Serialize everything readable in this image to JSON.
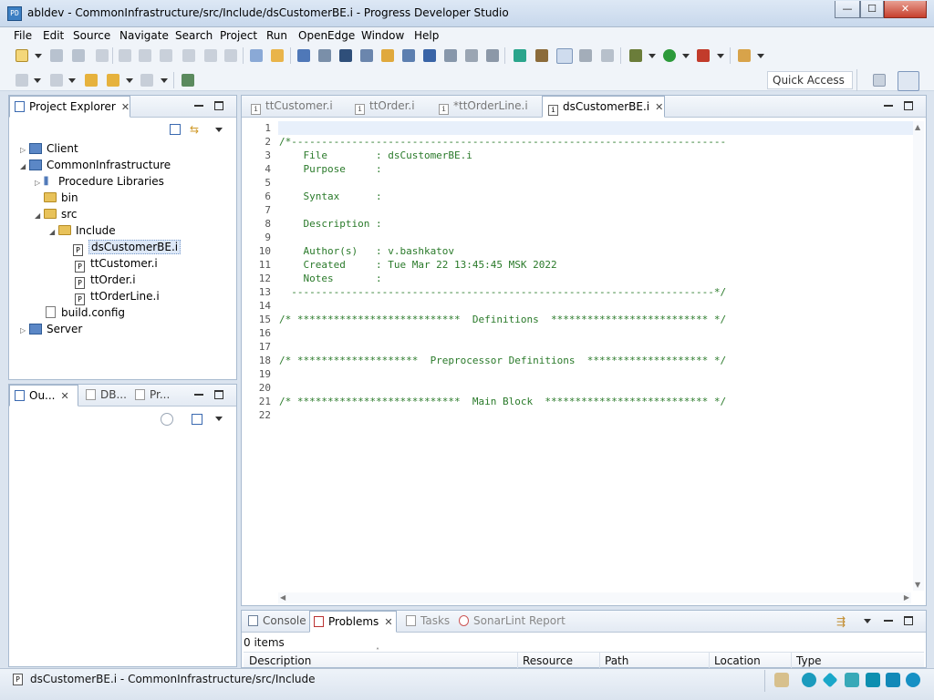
{
  "window": {
    "title": "abldev - CommonInfrastructure/src/Include/dsCustomerBE.i - Progress Developer Studio",
    "minimize": "—",
    "maximize": "☐",
    "close": "✕"
  },
  "menu": [
    "File",
    "Edit",
    "Source",
    "Navigate",
    "Search",
    "Project",
    "Run",
    "OpenEdge",
    "Window",
    "Help"
  ],
  "quick_access": "Quick Access",
  "explorer": {
    "tab_label": "Project Explorer",
    "tree": [
      {
        "label": "Client"
      },
      {
        "label": "CommonInfrastructure"
      },
      {
        "label": "Procedure Libraries"
      },
      {
        "label": "bin"
      },
      {
        "label": "src"
      },
      {
        "label": "Include"
      },
      {
        "label": "dsCustomerBE.i"
      },
      {
        "label": "ttCustomer.i"
      },
      {
        "label": "ttOrder.i"
      },
      {
        "label": "ttOrderLine.i"
      },
      {
        "label": "build.config"
      },
      {
        "label": "Server"
      }
    ]
  },
  "outline": {
    "tabs": [
      "Ou...",
      "DB...",
      "Pr..."
    ]
  },
  "editor": {
    "tabs": [
      "ttCustomer.i",
      "ttOrder.i",
      "*ttOrderLine.i",
      "dsCustomerBE.i"
    ],
    "lines": [
      "",
      "/*------------------------------------------------------------------------",
      "    File        : dsCustomerBE.i",
      "    Purpose     :",
      "",
      "    Syntax      :",
      "",
      "    Description :",
      "",
      "    Author(s)   : v.bashkatov",
      "    Created     : Tue Mar 22 13:45:45 MSK 2022",
      "    Notes       :",
      "  ----------------------------------------------------------------------*/",
      "",
      "/* ***************************  Definitions  ************************** */",
      "",
      "",
      "/* ********************  Preprocessor Definitions  ******************** */",
      "",
      "",
      "/* ***************************  Main Block  *************************** */",
      ""
    ]
  },
  "bottom": {
    "tabs": [
      "Console",
      "Problems",
      "Tasks",
      "SonarLint Report"
    ],
    "items_count": "0 items",
    "columns": [
      "Description",
      "Resource",
      "Path",
      "Location",
      "Type"
    ]
  },
  "status": {
    "path": "dsCustomerBE.i - CommonInfrastructure/src/Include"
  }
}
